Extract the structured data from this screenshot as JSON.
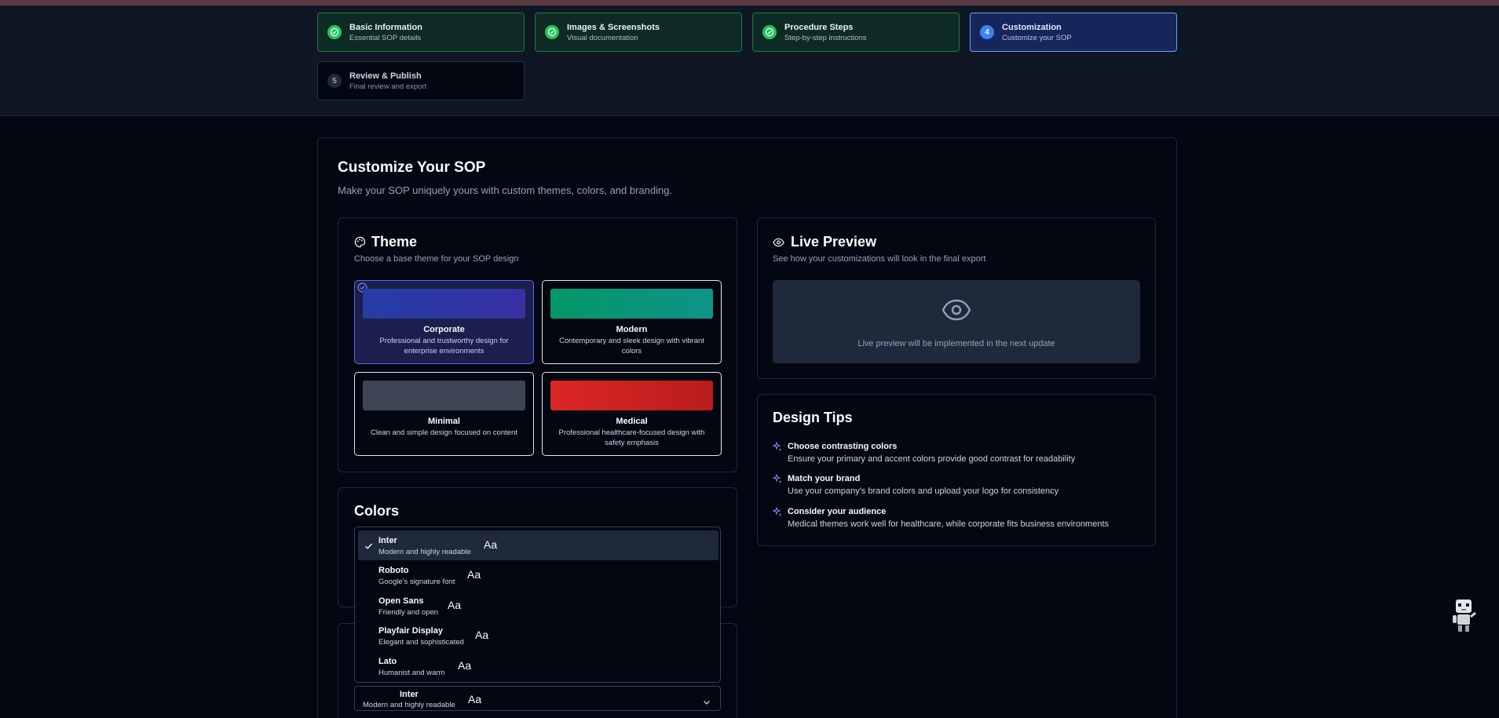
{
  "stepper": {
    "steps": [
      {
        "title": "Basic Information",
        "subtitle": "Essential SOP details",
        "state": "done"
      },
      {
        "title": "Images & Screenshots",
        "subtitle": "Visual documentation",
        "state": "done"
      },
      {
        "title": "Procedure Steps",
        "subtitle": "Step-by-step instructions",
        "state": "done"
      },
      {
        "number": "4",
        "title": "Customization",
        "subtitle": "Customize your SOP",
        "state": "active"
      },
      {
        "number": "5",
        "title": "Review & Publish",
        "subtitle": "Final review and export",
        "state": "pending"
      }
    ]
  },
  "page": {
    "title": "Customize Your SOP",
    "description": "Make your SOP uniquely yours with custom themes, colors, and branding."
  },
  "theme": {
    "title": "Theme",
    "subtitle": "Choose a base theme for your SOP design",
    "options": [
      {
        "name": "Corporate",
        "description": "Professional and trustworthy design for enterprise environments",
        "color": "#2b3bb3",
        "selected": true
      },
      {
        "name": "Modern",
        "description": "Contemporary and sleek design with vibrant colors",
        "color": "#0b9a78",
        "selected": false
      },
      {
        "name": "Minimal",
        "description": "Clean and simple design focused on content",
        "color": "#3d4554",
        "selected": false
      },
      {
        "name": "Medical",
        "description": "Professional healthcare-focused design with safety emphasis",
        "color": "#dc2626",
        "selected": false
      }
    ]
  },
  "colors": {
    "title": "Colors"
  },
  "preview": {
    "title": "Live Preview",
    "subtitle": "See how your customizations will look in the final export",
    "placeholder": "Live preview will be implemented in the next update"
  },
  "tips": {
    "title": "Design Tips",
    "items": [
      {
        "title": "Choose contrasting colors",
        "description": "Ensure your primary and accent colors provide good contrast for readability"
      },
      {
        "title": "Match your brand",
        "description": "Use your company's brand colors and upload your logo for consistency"
      },
      {
        "title": "Consider your audience",
        "description": "Medical themes work well for healthcare, while corporate fits business environments"
      }
    ]
  },
  "font_dropdown": {
    "options": [
      {
        "name": "Inter",
        "description": "Modern and highly readable",
        "sample": "Aa",
        "selected": true
      },
      {
        "name": "Roboto",
        "description": "Google's signature font",
        "sample": "Aa",
        "selected": false
      },
      {
        "name": "Open Sans",
        "description": "Friendly and open",
        "sample": "Aa",
        "selected": false
      },
      {
        "name": "Playfair Display",
        "description": "Elegant and sophisticated",
        "sample": "Aa",
        "selected": false
      },
      {
        "name": "Lato",
        "description": "Humanist and warm",
        "sample": "Aa",
        "selected": false
      }
    ],
    "current": {
      "name": "Inter",
      "description": "Modern and highly readable",
      "sample": "Aa"
    }
  },
  "icons": {
    "check": "check-icon",
    "palette": "palette-icon",
    "eye": "eye-icon",
    "sparkle": "sparkle-icon",
    "chevron": "chevron-down-icon",
    "robot": "robot-icon"
  }
}
